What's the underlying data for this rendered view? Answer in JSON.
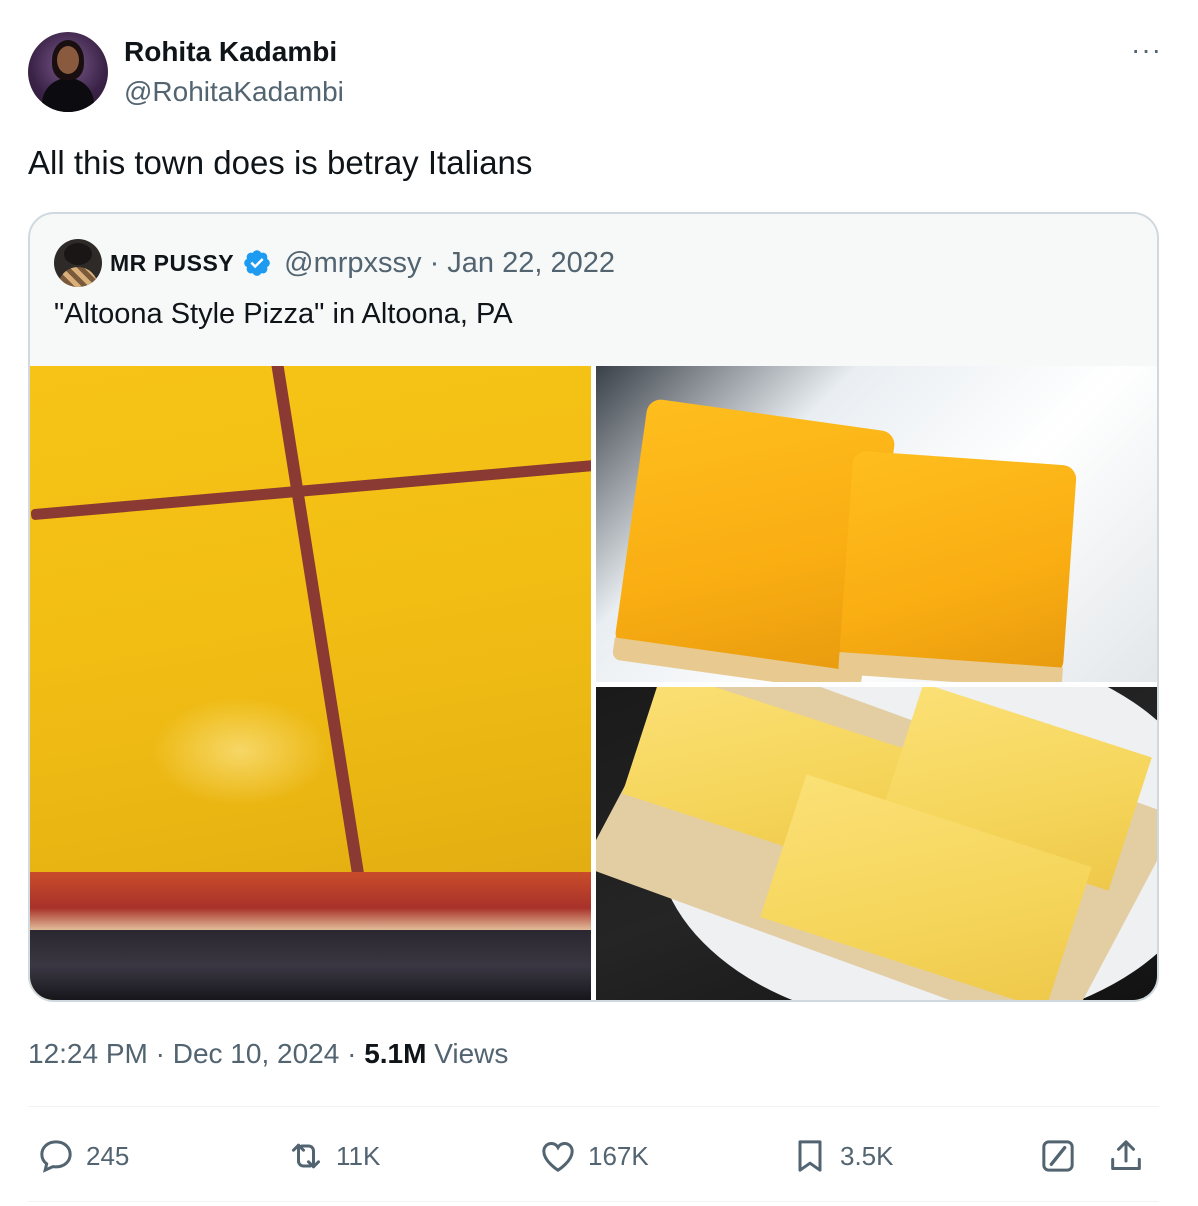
{
  "author": {
    "name": "Rohita Kadambi",
    "handle": "@RohitaKadambi"
  },
  "tweet": {
    "text": "All this town does is betray Italians"
  },
  "quoted": {
    "name": "MR PUSSY",
    "handle_date": "@mrpxssy · Jan 22, 2022",
    "text": "\"Altoona Style Pizza\" in Altoona, PA",
    "verified": true
  },
  "meta": {
    "timestamp": "12:24 PM · Dec 10, 2024 · ",
    "views_count": "5.1M",
    "views_label": " Views"
  },
  "actions": {
    "replies": "245",
    "reposts": "11K",
    "likes": "167K",
    "bookmarks": "3.5K"
  },
  "more_label": "···",
  "colors": {
    "text_primary": "#0f1419",
    "text_secondary": "#536471",
    "border": "#cfd9de",
    "verified_blue": "#1d9bf0"
  }
}
